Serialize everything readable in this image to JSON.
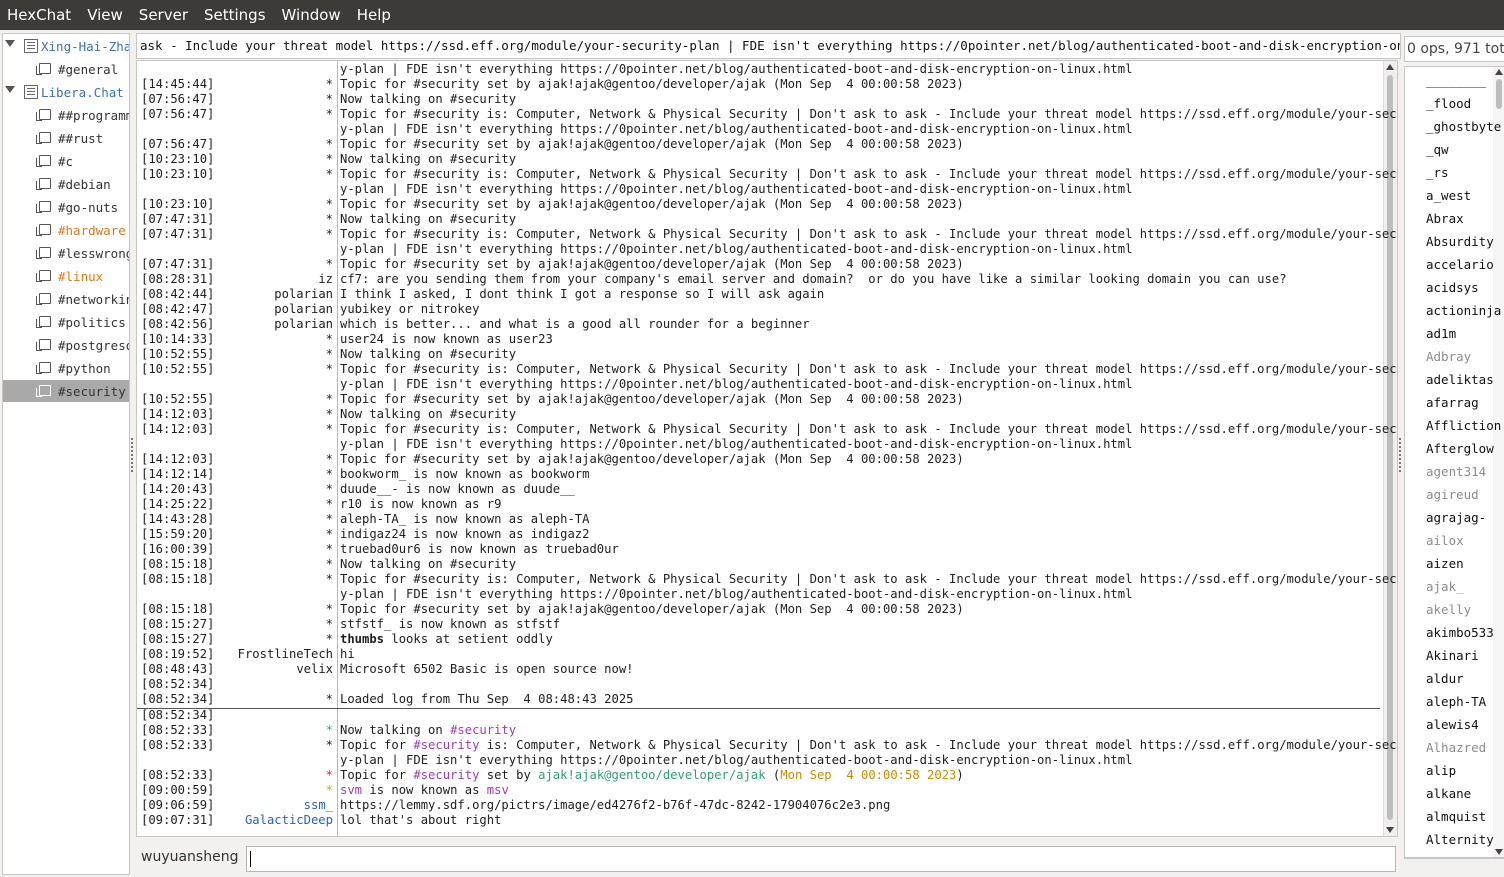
{
  "menu": [
    "HexChat",
    "View",
    "Server",
    "Settings",
    "Window",
    "Help"
  ],
  "tree": [
    {
      "type": "server",
      "label": "Xing-Hai-Zhan",
      "highlight": false,
      "selected": false
    },
    {
      "type": "channel",
      "label": "#general",
      "highlight": false,
      "selected": false
    },
    {
      "type": "server",
      "label": "Libera.Chat",
      "highlight": false,
      "selected": false
    },
    {
      "type": "channel",
      "label": "##programming",
      "highlight": false,
      "selected": false
    },
    {
      "type": "channel",
      "label": "##rust",
      "highlight": false,
      "selected": false
    },
    {
      "type": "channel",
      "label": "#c",
      "highlight": false,
      "selected": false
    },
    {
      "type": "channel",
      "label": "#debian",
      "highlight": false,
      "selected": false
    },
    {
      "type": "channel",
      "label": "#go-nuts",
      "highlight": false,
      "selected": false
    },
    {
      "type": "channel",
      "label": "#hardware",
      "highlight": true,
      "selected": false
    },
    {
      "type": "channel",
      "label": "#lesswrong",
      "highlight": false,
      "selected": false
    },
    {
      "type": "channel",
      "label": "#linux",
      "highlight": true,
      "selected": false
    },
    {
      "type": "channel",
      "label": "#networking",
      "highlight": false,
      "selected": false
    },
    {
      "type": "channel",
      "label": "#politics",
      "highlight": false,
      "selected": false
    },
    {
      "type": "channel",
      "label": "#postgresql",
      "highlight": false,
      "selected": false
    },
    {
      "type": "channel",
      "label": "#python",
      "highlight": false,
      "selected": false
    },
    {
      "type": "channel",
      "label": "#security",
      "highlight": false,
      "selected": true
    }
  ],
  "topic": "ask - Include your threat model https://ssd.eff.org/module/your-security-plan | FDE isn't everything https://0pointer.net/blog/authenticated-boot-and-disk-encryption-on-linux.html",
  "ops_count": "0 ops, 971 total",
  "colors": {
    "accent": "#3d6fb5",
    "highlight": "#d97a17",
    "nick_blue": "#2a5fbf",
    "nick_green": "#2f9e77",
    "nick_purple": "#9b3fb5",
    "date_orange": "#c78d00",
    "star_green": "#3aa55b",
    "star_red": "#cc2a2a",
    "star_orange": "#e0a020"
  },
  "messages": [
    {
      "ts": "",
      "nick": "",
      "msg": "y-plan | FDE isn't everything https://0pointer.net/blog/authenticated-boot-and-disk-encryption-on-linux.html"
    },
    {
      "ts": "[14:45:44]",
      "nick": "*",
      "msg": "Topic for #security set by ajak!ajak@gentoo/developer/ajak (Mon Sep  4 00:00:58 2023)"
    },
    {
      "ts": "[07:56:47]",
      "nick": "*",
      "msg": "Now talking on #security"
    },
    {
      "ts": "[07:56:47]",
      "nick": "*",
      "msg": "Topic for #security is: Computer, Network & Physical Security | Don't ask to ask - Include your threat model https://ssd.eff.org/module/your-securit"
    },
    {
      "ts": "",
      "nick": "",
      "msg": "y-plan | FDE isn't everything https://0pointer.net/blog/authenticated-boot-and-disk-encryption-on-linux.html"
    },
    {
      "ts": "[07:56:47]",
      "nick": "*",
      "msg": "Topic for #security set by ajak!ajak@gentoo/developer/ajak (Mon Sep  4 00:00:58 2023)"
    },
    {
      "ts": "[10:23:10]",
      "nick": "*",
      "msg": "Now talking on #security"
    },
    {
      "ts": "[10:23:10]",
      "nick": "*",
      "msg": "Topic for #security is: Computer, Network & Physical Security | Don't ask to ask - Include your threat model https://ssd.eff.org/module/your-securit"
    },
    {
      "ts": "",
      "nick": "",
      "msg": "y-plan | FDE isn't everything https://0pointer.net/blog/authenticated-boot-and-disk-encryption-on-linux.html"
    },
    {
      "ts": "[10:23:10]",
      "nick": "*",
      "msg": "Topic for #security set by ajak!ajak@gentoo/developer/ajak (Mon Sep  4 00:00:58 2023)"
    },
    {
      "ts": "[07:47:31]",
      "nick": "*",
      "msg": "Now talking on #security"
    },
    {
      "ts": "[07:47:31]",
      "nick": "*",
      "msg": "Topic for #security is: Computer, Network & Physical Security | Don't ask to ask - Include your threat model https://ssd.eff.org/module/your-securit"
    },
    {
      "ts": "",
      "nick": "",
      "msg": "y-plan | FDE isn't everything https://0pointer.net/blog/authenticated-boot-and-disk-encryption-on-linux.html"
    },
    {
      "ts": "[07:47:31]",
      "nick": "*",
      "msg": "Topic for #security set by ajak!ajak@gentoo/developer/ajak (Mon Sep  4 00:00:58 2023)"
    },
    {
      "ts": "[08:28:31]",
      "nick": "iz",
      "msg": "cf7: are you sending them from your company's email server and domain?  or do you have like a similar looking domain you can use?"
    },
    {
      "ts": "[08:42:44]",
      "nick": "polarian",
      "msg": "I think I asked, I dont think I got a response so I will ask again"
    },
    {
      "ts": "[08:42:47]",
      "nick": "polarian",
      "msg": "yubikey or nitrokey"
    },
    {
      "ts": "[08:42:56]",
      "nick": "polarian",
      "msg": "which is better... and what is a good all rounder for a beginner"
    },
    {
      "ts": "[10:14:33]",
      "nick": "*",
      "msg": "user24 is now known as user23"
    },
    {
      "ts": "[10:52:55]",
      "nick": "*",
      "msg": "Now talking on #security"
    },
    {
      "ts": "[10:52:55]",
      "nick": "*",
      "msg": "Topic for #security is: Computer, Network & Physical Security | Don't ask to ask - Include your threat model https://ssd.eff.org/module/your-securit"
    },
    {
      "ts": "",
      "nick": "",
      "msg": "y-plan | FDE isn't everything https://0pointer.net/blog/authenticated-boot-and-disk-encryption-on-linux.html"
    },
    {
      "ts": "[10:52:55]",
      "nick": "*",
      "msg": "Topic for #security set by ajak!ajak@gentoo/developer/ajak (Mon Sep  4 00:00:58 2023)"
    },
    {
      "ts": "[14:12:03]",
      "nick": "*",
      "msg": "Now talking on #security"
    },
    {
      "ts": "[14:12:03]",
      "nick": "*",
      "msg": "Topic for #security is: Computer, Network & Physical Security | Don't ask to ask - Include your threat model https://ssd.eff.org/module/your-securit"
    },
    {
      "ts": "",
      "nick": "",
      "msg": "y-plan | FDE isn't everything https://0pointer.net/blog/authenticated-boot-and-disk-encryption-on-linux.html"
    },
    {
      "ts": "[14:12:03]",
      "nick": "*",
      "msg": "Topic for #security set by ajak!ajak@gentoo/developer/ajak (Mon Sep  4 00:00:58 2023)"
    },
    {
      "ts": "[14:12:14]",
      "nick": "*",
      "msg": "bookworm_ is now known as bookworm"
    },
    {
      "ts": "[14:20:43]",
      "nick": "*",
      "msg": "duude__- is now known as duude__"
    },
    {
      "ts": "[14:25:22]",
      "nick": "*",
      "msg": "r10 is now known as r9"
    },
    {
      "ts": "[14:43:28]",
      "nick": "*",
      "msg": "aleph-TA_ is now known as aleph-TA"
    },
    {
      "ts": "[15:59:20]",
      "nick": "*",
      "msg": "indigaz24 is now known as indigaz2"
    },
    {
      "ts": "[16:00:39]",
      "nick": "*",
      "msg": "truebad0ur6 is now known as truebad0ur"
    },
    {
      "ts": "[08:15:18]",
      "nick": "*",
      "msg": "Now talking on #security"
    },
    {
      "ts": "[08:15:18]",
      "nick": "*",
      "msg": "Topic for #security is: Computer, Network & Physical Security | Don't ask to ask - Include your threat model https://ssd.eff.org/module/your-securit"
    },
    {
      "ts": "",
      "nick": "",
      "msg": "y-plan | FDE isn't everything https://0pointer.net/blog/authenticated-boot-and-disk-encryption-on-linux.html"
    },
    {
      "ts": "[08:15:18]",
      "nick": "*",
      "msg": "Topic for #security set by ajak!ajak@gentoo/developer/ajak (Mon Sep  4 00:00:58 2023)"
    },
    {
      "ts": "[08:15:27]",
      "nick": "*",
      "msg": "stfstf_ is now known as stfstf"
    },
    {
      "ts": "[08:15:27]",
      "nick": "*",
      "msg": "thumbs looks at setient oddly",
      "bold_prefix": "thumbs"
    },
    {
      "ts": "[08:19:52]",
      "nick": "FrostlineTech",
      "msg": "hi"
    },
    {
      "ts": "[08:48:43]",
      "nick": "velix",
      "msg": "Microsoft 6502 Basic is open source now!"
    },
    {
      "ts": "[08:52:34]",
      "nick": "",
      "msg": ""
    },
    {
      "ts": "[08:52:34]",
      "nick": "*",
      "msg": "Loaded log from Thu Sep  4 08:48:43 2025"
    },
    {
      "ts": "[08:52:34]",
      "nick": "",
      "msg": ""
    },
    {
      "ts": "[08:52:33]",
      "nick": "*",
      "msg": "Now talking on #security",
      "colored": "talk",
      "star": "green"
    },
    {
      "ts": "[08:52:33]",
      "nick": "*",
      "msg": "Topic for #security is: Computer, Network & Physical Security | Don't ask to ask - Include your threat model https://ssd.eff.org/module/your-securit",
      "colored": "topic",
      "star": "purple"
    },
    {
      "ts": "",
      "nick": "",
      "msg": "y-plan | FDE isn't everything https://0pointer.net/blog/authenticated-boot-and-disk-encryption-on-linux.html"
    },
    {
      "ts": "[08:52:33]",
      "nick": "*",
      "msg": "Topic for #security set by ajak!ajak@gentoo/developer/ajak (Mon Sep  4 00:00:58 2023)",
      "colored": "setby",
      "star": "red"
    },
    {
      "ts": "[09:00:59]",
      "nick": "*",
      "msg": "svm is now known as msv",
      "colored": "rename",
      "star": "orange"
    },
    {
      "ts": "[09:06:59]",
      "nick": "ssm_",
      "msg": "https://lemmy.sdf.org/pictrs/image/ed4276f2-b76f-47dc-8242-17904076c2e3.png",
      "nickcolor": "nick_blue"
    },
    {
      "ts": "[09:07:31]",
      "nick": "GalacticDeep",
      "msg": "lol that's about right",
      "nickcolor": "nick_blue"
    }
  ],
  "users": [
    {
      "name": "________",
      "away": false
    },
    {
      "name": "_flood",
      "away": false
    },
    {
      "name": "_ghostbyte",
      "away": false
    },
    {
      "name": "_qw",
      "away": false
    },
    {
      "name": "_rs",
      "away": false
    },
    {
      "name": "a_west",
      "away": false
    },
    {
      "name": "Abrax",
      "away": false
    },
    {
      "name": "Absurdity",
      "away": false
    },
    {
      "name": "accelario",
      "away": false
    },
    {
      "name": "acidsys",
      "away": false
    },
    {
      "name": "actioninja",
      "away": false
    },
    {
      "name": "ad1m",
      "away": false
    },
    {
      "name": "Adbray",
      "away": true
    },
    {
      "name": "adeliktas",
      "away": false
    },
    {
      "name": "afarrag",
      "away": false
    },
    {
      "name": "Affliction",
      "away": false
    },
    {
      "name": "Afterglow",
      "away": false
    },
    {
      "name": "agent314",
      "away": true
    },
    {
      "name": "agireud",
      "away": true
    },
    {
      "name": "agrajag-",
      "away": false
    },
    {
      "name": "ailox",
      "away": true
    },
    {
      "name": "aizen",
      "away": false
    },
    {
      "name": "ajak_",
      "away": true
    },
    {
      "name": "akelly",
      "away": true
    },
    {
      "name": "akimbo533",
      "away": false
    },
    {
      "name": "Akinari",
      "away": false
    },
    {
      "name": "aldur",
      "away": false
    },
    {
      "name": "aleph-TA",
      "away": false
    },
    {
      "name": "alewis4",
      "away": false
    },
    {
      "name": "Alhazred",
      "away": true
    },
    {
      "name": "alip",
      "away": false
    },
    {
      "name": "alkane",
      "away": false
    },
    {
      "name": "almquist",
      "away": false
    },
    {
      "name": "Alternity",
      "away": false
    }
  ],
  "input": {
    "nick": "wuyuansheng",
    "value": ""
  }
}
